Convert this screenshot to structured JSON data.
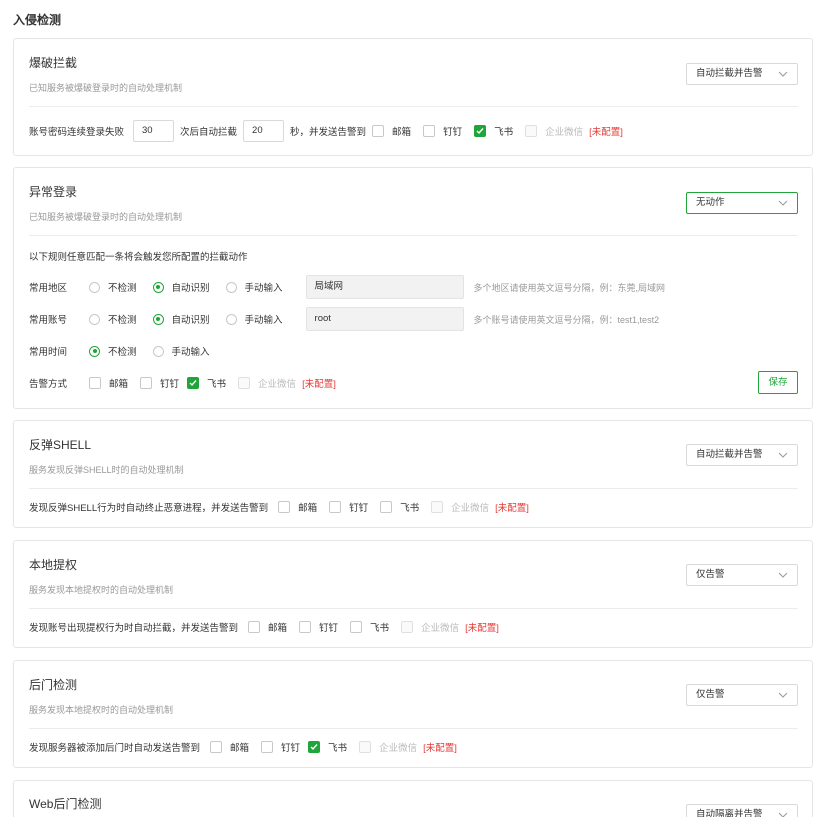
{
  "page_title": "入侵检测",
  "brute_force": {
    "title": "爆破拦截",
    "desc": "已知服务被爆破登录时的自动处理机制",
    "action": "自动拦截并告警",
    "text1": "账号密码连续登录失败",
    "fail_count": "30",
    "text2": "次后自动拦截",
    "block_seconds": "20",
    "text3": "秒，并发送告警到"
  },
  "abnormal_login": {
    "title": "异常登录",
    "desc": "已知服务被爆破登录时的自动处理机制",
    "action": "无动作",
    "rule_note": "以下规则任意匹配一条将会触发您所配置的拦截动作",
    "region": {
      "label": "常用地区",
      "opt_none": "不检测",
      "opt_auto": "自动识别",
      "opt_manual": "手动输入",
      "value": "局域网",
      "hint": "多个地区请使用英文逗号分隔，例：东莞,局域网"
    },
    "account": {
      "label": "常用账号",
      "opt_none": "不检测",
      "opt_auto": "自动识别",
      "opt_manual": "手动输入",
      "value": "root",
      "hint": "多个账号请使用英文逗号分隔，例：test1,test2"
    },
    "time": {
      "label": "常用时间",
      "opt_none": "不检测",
      "opt_manual": "手动输入"
    },
    "alert_label": "告警方式",
    "save": "保存"
  },
  "reverse_shell": {
    "title": "反弹SHELL",
    "desc": "服务发现反弹SHELL时的自动处理机制",
    "action": "自动拦截并告警",
    "text": "发现反弹SHELL行为时自动终止恶意进程，并发送告警到"
  },
  "privilege": {
    "title": "本地提权",
    "desc": "服务发现本地提权时的自动处理机制",
    "action": "仅告警",
    "text": "发现账号出现提权行为时自动拦截，并发送告警到"
  },
  "backdoor": {
    "title": "后门检测",
    "desc": "服务发现本地提权时的自动处理机制",
    "action": "仅告警",
    "text": "发现服务器被添加后门时自动发送告警到"
  },
  "web_backdoor": {
    "title": "Web后门检测",
    "action": "自动隔离并告警"
  },
  "channels": {
    "email": "邮箱",
    "dingtalk": "钉钉",
    "feishu": "飞书",
    "wecom": "企业微信",
    "unconfigured": "[未配置]"
  },
  "colors": {
    "accent": "#20a53a",
    "danger": "#e53935"
  }
}
